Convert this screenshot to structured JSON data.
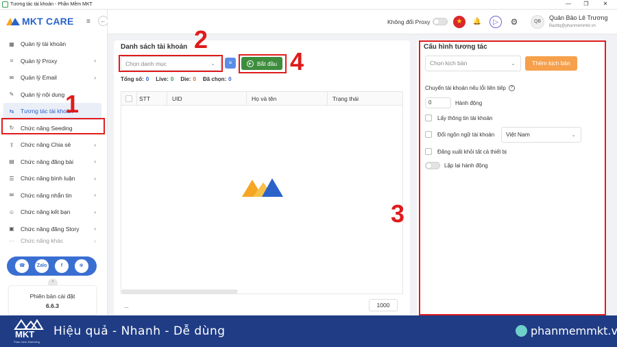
{
  "window": {
    "title": "Tương tác tài khoản - Phần Mềm MKT",
    "minimize": "—",
    "maximize": "❐",
    "close": "✕"
  },
  "sidebar": {
    "brand": "MKT CARE",
    "menu_toggle": "≡",
    "collapse": "←",
    "items": [
      {
        "label": "Quản lý tài khoản",
        "icon": "▦",
        "chevron": ""
      },
      {
        "label": "Quản lý Proxy",
        "icon": "⌗",
        "chevron": "›"
      },
      {
        "label": "Quản lý Email",
        "icon": "✉",
        "chevron": "›"
      },
      {
        "label": "Quản lý nội dung",
        "icon": "✎",
        "chevron": ""
      },
      {
        "label": "Tương tác tài khoản",
        "icon": "⇆",
        "chevron": ""
      },
      {
        "label": "Chức năng Seeding",
        "icon": "↻",
        "chevron": ""
      },
      {
        "label": "Chức năng Chia sẻ",
        "icon": "⇪",
        "chevron": "›"
      },
      {
        "label": "Chức năng đăng bài",
        "icon": "▤",
        "chevron": "›"
      },
      {
        "label": "Chức năng bình luận",
        "icon": "☰",
        "chevron": "›"
      },
      {
        "label": "Chức năng nhắn tin",
        "icon": "✉",
        "chevron": "›"
      },
      {
        "label": "Chức năng kết bạn",
        "icon": "☺",
        "chevron": "›"
      },
      {
        "label": "Chức năng đăng Story",
        "icon": "▣",
        "chevron": "›"
      },
      {
        "label": "Chức năng khác",
        "icon": "⋯",
        "chevron": "›"
      }
    ],
    "social": [
      "☎",
      "Zalo",
      "f",
      "⊕"
    ],
    "scroll_up": "⌃",
    "version_label": "Phiên bản cài đặt",
    "version_number": "6.6.3"
  },
  "header": {
    "proxy_label": "Không đổi Proxy",
    "flag": "★",
    "bell": "🔔",
    "play": "▷",
    "settings": "⚙",
    "avatar_initials": "QB",
    "user_name": "Quản Bảo Lê Trương",
    "user_email": "Baottq@phanmemmkt.vn"
  },
  "accounts": {
    "title": "Danh sách tài khoản",
    "category_placeholder": "Chọn danh mục",
    "filter": "≡",
    "start_label": "Bắt đầu",
    "stats": {
      "total_label": "Tổng số:",
      "total": "0",
      "live_label": "Live:",
      "live": "0",
      "die_label": "Die:",
      "die": "0",
      "selected_label": "Đã chọn:",
      "selected": "0"
    },
    "columns": [
      "STT",
      "UID",
      "Họ và tên",
      "Trạng thái"
    ],
    "pagination_dots": "...",
    "page_size": "1000"
  },
  "config": {
    "title": "Cấu hình tương tác",
    "script_placeholder": "Chọn kịch bản",
    "add_script": "Thêm kịch bản",
    "switch_label": "Chuyển tài khoản nếu lỗi liên tiếp",
    "help": "?",
    "action_count": "0",
    "action_label": "Hành động",
    "get_info": "Lấy thông tin tài khoản",
    "change_lang": "Đổi ngôn ngữ tài khoản",
    "language": "Việt Nam",
    "logout_all": "Đăng xuất khỏi tất cả thiết bị",
    "repeat": "Lặp lại hành động"
  },
  "annotations": [
    "1",
    "2",
    "3",
    "4"
  ],
  "footer": {
    "logo": "MKT",
    "logo_sub": "Phần mềm Marketing",
    "slogan": "Hiệu quả - Nhanh  - Dễ dùng",
    "site": "phanmemmkt.vn"
  },
  "colors": {
    "brand": "#2a62c9",
    "start": "#3d8d3d",
    "add": "#f6a04b",
    "annotation": "#e01b1b",
    "footer": "#1f3c85"
  }
}
